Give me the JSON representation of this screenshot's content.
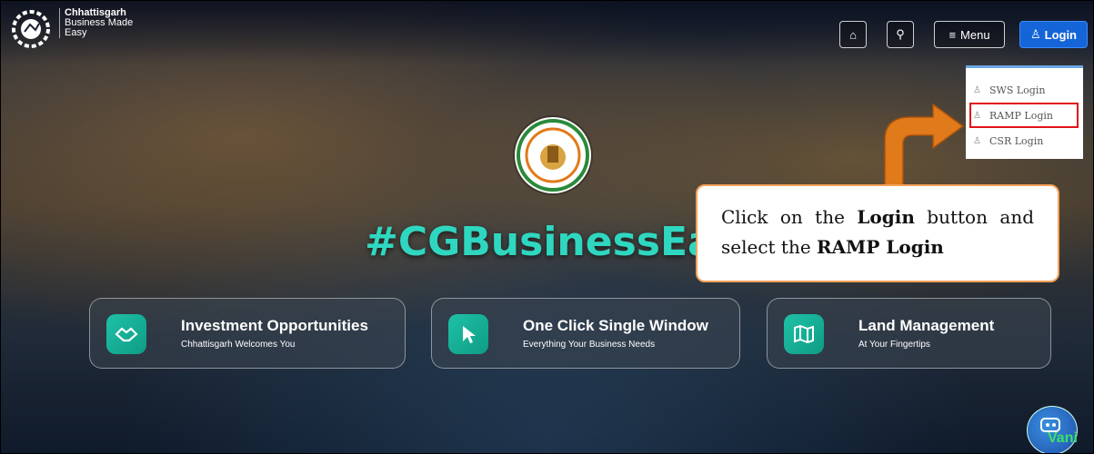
{
  "brand": {
    "line1": "Chhattisgarh",
    "line2": "Business Made",
    "line3": "Easy"
  },
  "nav": {
    "menu_label": "Menu",
    "login_label": "Login"
  },
  "dropdown": {
    "items": [
      {
        "label": "SWS Login"
      },
      {
        "label": "RAMP Login"
      },
      {
        "label": "CSR Login"
      }
    ]
  },
  "hero": {
    "hashtag": "#CGBusinessEa"
  },
  "cards": [
    {
      "title": "Investment Opportunities",
      "subtitle": "Chhattisgarh Welcomes You"
    },
    {
      "title": "One Click Single Window",
      "subtitle": "Everything Your Business Needs"
    },
    {
      "title": "Land Management",
      "subtitle": "At Your Fingertips"
    }
  ],
  "callout": {
    "p1": "Click on the",
    "login": "Login",
    "p2": "button and select the",
    "ramp": "RAMP Login"
  },
  "assistant": {
    "label": "Vani"
  },
  "colors": {
    "accent_teal": "#2fd7c0",
    "login_blue": "#1565d8",
    "arrow_orange": "#e07a1a",
    "highlight_red": "#e01414"
  }
}
